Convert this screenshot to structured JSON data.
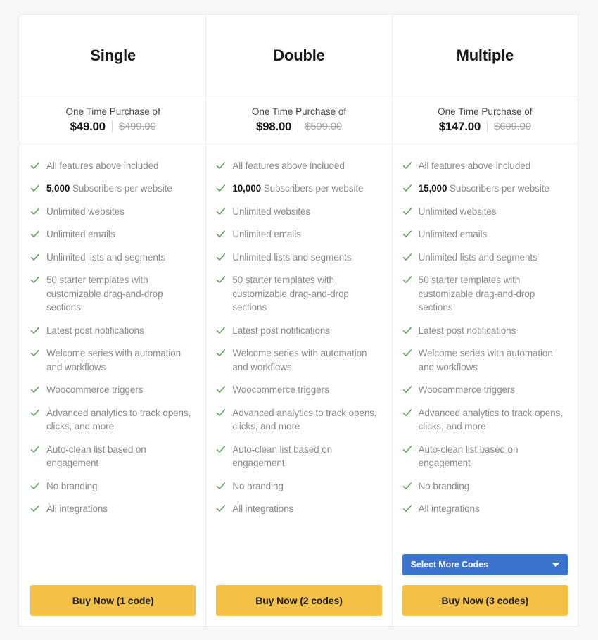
{
  "colors": {
    "page_background": "#f7f7f7",
    "card_background": "#ffffff",
    "card_border": "#ededed",
    "check_green": "#52a352",
    "feature_text": "#8a8a8a",
    "buy_button": "#f5c144",
    "dropdown_blue": "#3b73d1",
    "price_old": "#a9a9a9"
  },
  "price_caption": "One Time Purchase of",
  "plans": [
    {
      "name": "Single",
      "price_caption": "One Time Purchase of",
      "price_now": "$49.00",
      "price_was": "$499.00",
      "features": [
        {
          "text": "All features above included",
          "bold": ""
        },
        {
          "text": "Subscribers per website",
          "bold": "5,000"
        },
        {
          "text": "Unlimited websites",
          "bold": ""
        },
        {
          "text": "Unlimited emails",
          "bold": ""
        },
        {
          "text": "Unlimited lists and segments",
          "bold": ""
        },
        {
          "text": "50 starter templates with customizable drag-and-drop sections",
          "bold": ""
        },
        {
          "text": "Latest post notifications",
          "bold": ""
        },
        {
          "text": "Welcome series with automation and workflows",
          "bold": ""
        },
        {
          "text": "Woocommerce triggers",
          "bold": ""
        },
        {
          "text": "Advanced analytics to track opens, clicks, and more",
          "bold": ""
        },
        {
          "text": "Auto-clean list based on engagement",
          "bold": ""
        },
        {
          "text": "No branding",
          "bold": ""
        },
        {
          "text": "All integrations",
          "bold": ""
        }
      ],
      "has_dropdown": false,
      "dropdown_label": "",
      "cta_label": "Buy Now (1 code)"
    },
    {
      "name": "Double",
      "price_caption": "One Time Purchase of",
      "price_now": "$98.00",
      "price_was": "$599.00",
      "features": [
        {
          "text": "All features above included",
          "bold": ""
        },
        {
          "text": "Subscribers per website",
          "bold": "10,000"
        },
        {
          "text": "Unlimited websites",
          "bold": ""
        },
        {
          "text": "Unlimited emails",
          "bold": ""
        },
        {
          "text": "Unlimited lists and segments",
          "bold": ""
        },
        {
          "text": "50 starter templates with customizable drag-and-drop sections",
          "bold": ""
        },
        {
          "text": "Latest post notifications",
          "bold": ""
        },
        {
          "text": "Welcome series with automation and workflows",
          "bold": ""
        },
        {
          "text": "Woocommerce triggers",
          "bold": ""
        },
        {
          "text": "Advanced analytics to track opens, clicks, and more",
          "bold": ""
        },
        {
          "text": "Auto-clean list based on engagement",
          "bold": ""
        },
        {
          "text": "No branding",
          "bold": ""
        },
        {
          "text": "All integrations",
          "bold": ""
        }
      ],
      "has_dropdown": false,
      "dropdown_label": "",
      "cta_label": "Buy Now (2 codes)"
    },
    {
      "name": "Multiple",
      "price_caption": "One Time Purchase of",
      "price_now": "$147.00",
      "price_was": "$699.00",
      "features": [
        {
          "text": "All features above included",
          "bold": ""
        },
        {
          "text": "Subscribers per website",
          "bold": "15,000"
        },
        {
          "text": "Unlimited websites",
          "bold": ""
        },
        {
          "text": "Unlimited emails",
          "bold": ""
        },
        {
          "text": "Unlimited lists and segments",
          "bold": ""
        },
        {
          "text": "50 starter templates with customizable drag-and-drop sections",
          "bold": ""
        },
        {
          "text": "Latest post notifications",
          "bold": ""
        },
        {
          "text": "Welcome series with automation and workflows",
          "bold": ""
        },
        {
          "text": "Woocommerce triggers",
          "bold": ""
        },
        {
          "text": "Advanced analytics to track opens, clicks, and more",
          "bold": ""
        },
        {
          "text": "Auto-clean list based on engagement",
          "bold": ""
        },
        {
          "text": "No branding",
          "bold": ""
        },
        {
          "text": "All integrations",
          "bold": ""
        }
      ],
      "has_dropdown": true,
      "dropdown_label": "Select More Codes",
      "cta_label": "Buy Now (3 codes)"
    }
  ],
  "icons": {
    "check": "check-icon",
    "chevron": "chevron-down-icon"
  }
}
